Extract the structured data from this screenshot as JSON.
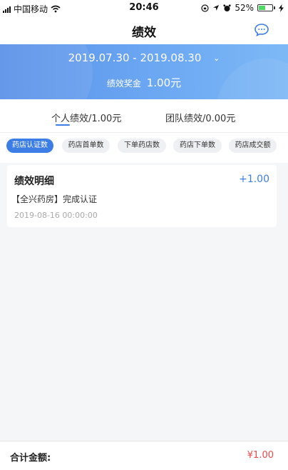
{
  "status_bar": {
    "carrier": "中国移动",
    "time": "20:46",
    "battery_percent": "52%",
    "battery_level": 0.52,
    "icons": [
      "signal-icon",
      "wifi-icon",
      "lock-rotation-icon",
      "location-icon",
      "alarm-icon",
      "battery-icon",
      "charging-icon"
    ]
  },
  "nav": {
    "title": "绩效",
    "right_icon": "chat-bubble-icon"
  },
  "header": {
    "date_range": "2019.07.30 - 2019.08.30",
    "bonus_label": "绩效奖金",
    "bonus_value": "1.00元"
  },
  "main_tabs": [
    {
      "label": "个人绩效/1.00元",
      "active": true
    },
    {
      "label": "团队绩效/0.00元",
      "active": false
    }
  ],
  "chips": [
    {
      "label": "药店认证数",
      "active": true
    },
    {
      "label": "药店首单数",
      "active": false
    },
    {
      "label": "下单药店数",
      "active": false
    },
    {
      "label": "药店下单数",
      "active": false
    },
    {
      "label": "药店成交额",
      "active": false
    }
  ],
  "card": {
    "title": "绩效明细",
    "amount": "+1.00",
    "description": "【全兴药房】完成认证",
    "timestamp": "2019-08-16 00:00:00"
  },
  "footer": {
    "label": "合计金额:",
    "value": "¥1.00"
  },
  "colors": {
    "accent": "#3d7ee6",
    "banner_start": "#5a90e8",
    "total": "#e94b4b"
  }
}
